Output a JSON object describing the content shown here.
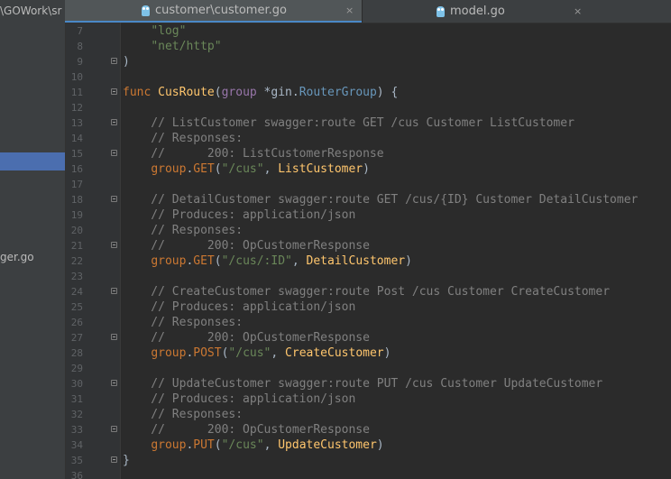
{
  "project": {
    "path_fragment": "\\GOWork\\sr",
    "file_fragment": "ger.go"
  },
  "tabs": [
    {
      "label": "customer\\customer.go",
      "close": "×",
      "icon": "go-gopher-icon",
      "active": true
    },
    {
      "label": "model.go",
      "close": "×",
      "icon": "go-gopher-icon",
      "active": false
    }
  ],
  "editor": {
    "lines": [
      {
        "n": "7",
        "tokens": [
          {
            "t": "    "
          },
          {
            "t": "\"log\"",
            "c": "str"
          }
        ]
      },
      {
        "n": "8",
        "tokens": [
          {
            "t": "    "
          },
          {
            "t": "\"net/http\"",
            "c": "str"
          }
        ]
      },
      {
        "n": "9",
        "fold": true,
        "tokens": [
          {
            "t": ")"
          }
        ]
      },
      {
        "n": "10",
        "tokens": []
      },
      {
        "n": "11",
        "fold": true,
        "tokens": [
          {
            "t": "func",
            "c": "kw"
          },
          {
            "t": " "
          },
          {
            "t": "CusRoute",
            "c": "fn"
          },
          {
            "t": "("
          },
          {
            "t": "group",
            "c": "pk"
          },
          {
            "t": " *gin."
          },
          {
            "t": "RouterGroup",
            "c": "ty"
          },
          {
            "t": ") {"
          }
        ]
      },
      {
        "n": "12",
        "tokens": []
      },
      {
        "n": "13",
        "fold": true,
        "tokens": [
          {
            "t": "    // ListCustomer swagger:route GET /cus Customer ListCustomer",
            "c": "cm"
          }
        ]
      },
      {
        "n": "14",
        "tokens": [
          {
            "t": "    // Responses:",
            "c": "cm"
          }
        ]
      },
      {
        "n": "15",
        "fold": true,
        "tokens": [
          {
            "t": "    //      200: ListCustomerResponse",
            "c": "cm"
          }
        ]
      },
      {
        "n": "16",
        "tokens": [
          {
            "t": "    "
          },
          {
            "t": "group",
            "c": "ms"
          },
          {
            "t": "."
          },
          {
            "t": "GET",
            "c": "ms"
          },
          {
            "t": "("
          },
          {
            "t": "\"/cus\"",
            "c": "str"
          },
          {
            "t": ", "
          },
          {
            "t": "ListCustomer",
            "c": "fn"
          },
          {
            "t": ")"
          }
        ]
      },
      {
        "n": "17",
        "tokens": []
      },
      {
        "n": "18",
        "fold": true,
        "tokens": [
          {
            "t": "    // DetailCustomer swagger:route GET /cus/{ID} Customer DetailCustomer",
            "c": "cm"
          }
        ]
      },
      {
        "n": "19",
        "tokens": [
          {
            "t": "    // Produces: application/json",
            "c": "cm"
          }
        ]
      },
      {
        "n": "20",
        "tokens": [
          {
            "t": "    // Responses:",
            "c": "cm"
          }
        ]
      },
      {
        "n": "21",
        "fold": true,
        "tokens": [
          {
            "t": "    //      200: OpCustomerResponse",
            "c": "cm"
          }
        ]
      },
      {
        "n": "22",
        "tokens": [
          {
            "t": "    "
          },
          {
            "t": "group",
            "c": "ms"
          },
          {
            "t": "."
          },
          {
            "t": "GET",
            "c": "ms"
          },
          {
            "t": "("
          },
          {
            "t": "\"/cus/:ID\"",
            "c": "str"
          },
          {
            "t": ", "
          },
          {
            "t": "DetailCustomer",
            "c": "fn"
          },
          {
            "t": ")"
          }
        ]
      },
      {
        "n": "23",
        "tokens": []
      },
      {
        "n": "24",
        "fold": true,
        "tokens": [
          {
            "t": "    // CreateCustomer swagger:route Post /cus Customer CreateCustomer",
            "c": "cm"
          }
        ]
      },
      {
        "n": "25",
        "tokens": [
          {
            "t": "    // Produces: application/json",
            "c": "cm"
          }
        ]
      },
      {
        "n": "26",
        "tokens": [
          {
            "t": "    // Responses:",
            "c": "cm"
          }
        ]
      },
      {
        "n": "27",
        "fold": true,
        "tokens": [
          {
            "t": "    //      200: OpCustomerResponse",
            "c": "cm"
          }
        ]
      },
      {
        "n": "28",
        "tokens": [
          {
            "t": "    "
          },
          {
            "t": "group",
            "c": "ms"
          },
          {
            "t": "."
          },
          {
            "t": "POST",
            "c": "ms"
          },
          {
            "t": "("
          },
          {
            "t": "\"/cus\"",
            "c": "str"
          },
          {
            "t": ", "
          },
          {
            "t": "CreateCustomer",
            "c": "fn"
          },
          {
            "t": ")"
          }
        ]
      },
      {
        "n": "29",
        "tokens": []
      },
      {
        "n": "30",
        "fold": true,
        "tokens": [
          {
            "t": "    // UpdateCustomer swagger:route PUT /cus Customer UpdateCustomer",
            "c": "cm"
          }
        ]
      },
      {
        "n": "31",
        "tokens": [
          {
            "t": "    // Produces: application/json",
            "c": "cm"
          }
        ]
      },
      {
        "n": "32",
        "tokens": [
          {
            "t": "    // Responses:",
            "c": "cm"
          }
        ]
      },
      {
        "n": "33",
        "fold": true,
        "tokens": [
          {
            "t": "    //      200: OpCustomerResponse",
            "c": "cm"
          }
        ]
      },
      {
        "n": "34",
        "tokens": [
          {
            "t": "    "
          },
          {
            "t": "group",
            "c": "ms"
          },
          {
            "t": "."
          },
          {
            "t": "PUT",
            "c": "ms"
          },
          {
            "t": "("
          },
          {
            "t": "\"/cus\"",
            "c": "str"
          },
          {
            "t": ", "
          },
          {
            "t": "UpdateCustomer",
            "c": "fn"
          },
          {
            "t": ")"
          }
        ]
      },
      {
        "n": "35",
        "fold": true,
        "tokens": [
          {
            "t": "}"
          }
        ]
      },
      {
        "n": "36",
        "tokens": []
      }
    ]
  },
  "colors": {
    "background": "#2b2b2b",
    "keyword": "#cc7832",
    "function": "#ffc66d",
    "string": "#6a8759",
    "comment": "#808080",
    "selection": "#4b6eaf"
  }
}
